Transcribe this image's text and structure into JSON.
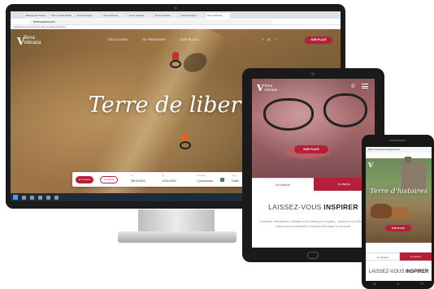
{
  "desktop": {
    "browser_tabs": [
      "Webagentur Saxos",
      "FUT Creatio Phala",
      "Terra Volcana",
      "Terra Volcana",
      "Terra Volcana",
      "Terra Volcana",
      "Terra Volcana",
      "Terra Volcana"
    ],
    "url": "terravolcana.com",
    "bookmarks": "Applications   Gmail   YouTube   Maps   Actualités   Traduction",
    "site": {
      "logo_mark": "V",
      "logo_line1": "Terra",
      "logo_line2": "Volcana",
      "nav": [
        "DÉCOUVRIR",
        "SE PRÉPARER",
        "SUR PLACE"
      ],
      "social": [
        "f",
        "◎",
        "♡"
      ],
      "sur_place_button": "SUR PLACE",
      "hero_title": "Terre de liberté",
      "search": {
        "btn1": "Je m'inspire",
        "btn2": "Je réserve",
        "from_label": "Du",
        "from_value": "08/11/2020",
        "to_label": "Au",
        "to_value": "10/11/2020",
        "people_label": "Personnes",
        "people_value": "2 personnes",
        "type_label": "Type",
        "type_value": "Hôtel"
      }
    },
    "taskbar_clock": "12:00"
  },
  "tablet": {
    "logo_mark": "V",
    "logo_line1": "Terra",
    "logo_line2": "Volcana",
    "phone_glyph": "✆",
    "sur_place_button": "SUR PLACE",
    "tab1": "Je m'inspire",
    "tab2": "Je réserve",
    "heading_light": "LAISSEZ-VOUS ",
    "heading_bold": "INSPIRER",
    "paragraph": "Sommets, thématiques, balades et de contes pour inspirer... envies et vos idées de séjour dans la destination Volcans d'Auvergne à découvrir."
  },
  "phone": {
    "url": "https://www.terravolcana.com",
    "logo_mark": "V",
    "hero_title": "Terre d'histoires",
    "button": "SUR PLACE",
    "tab1": "Je m'inspire",
    "tab2": "Je réserve",
    "heading_light": "LAISSEZ-VOUS ",
    "heading_bold": "INSPIRER",
    "nav_buttons": [
      "◁",
      "○",
      "□"
    ]
  }
}
